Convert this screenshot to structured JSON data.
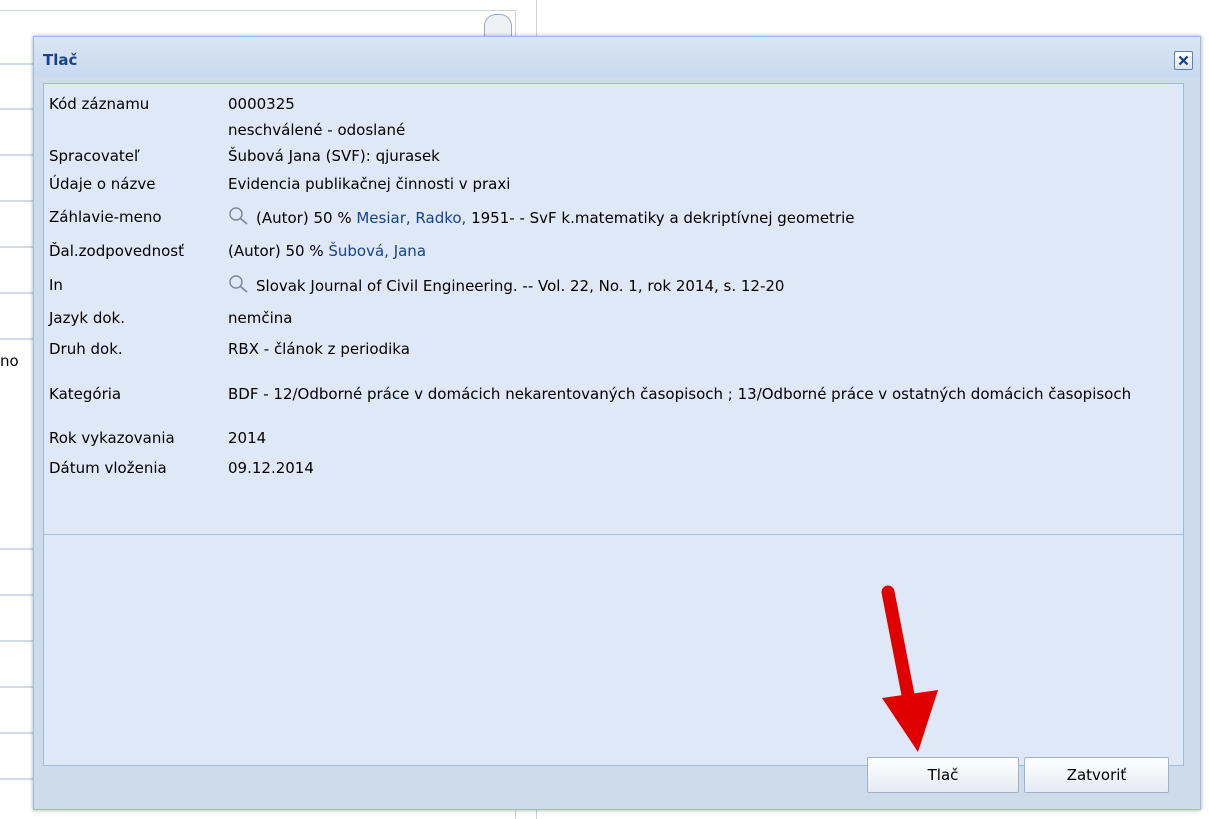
{
  "background": {
    "left_fragment": "no"
  },
  "dialog": {
    "title": "Tlač",
    "rows": [
      {
        "label": "Kód záznamu",
        "value": "0000325"
      },
      {
        "label": "",
        "value": "neschválené - odoslané"
      },
      {
        "label": "Spracovateľ",
        "value": "Šubová Jana (SVF): qjurasek"
      },
      {
        "label": "Údaje o názve",
        "value": "Evidencia publikačnej činnosti v praxi"
      },
      {
        "label": "Záhlavie-meno",
        "prefix": "(Autor) 50 %",
        "link": "Mesiar, Radko,",
        "suffix": "1951- - SvF k.matematiky a dekriptívnej geometrie",
        "icon": "search-icon"
      },
      {
        "label": "Ďal.zodpovednosť",
        "prefix": "(Autor) 50 %",
        "link": "Šubová, Jana"
      },
      {
        "label": "In",
        "value": "Slovak Journal of Civil Engineering. -- Vol. 22, No. 1, rok 2014, s. 12-20",
        "icon": "search-icon"
      },
      {
        "label": "Jazyk dok.",
        "value": "nemčina"
      },
      {
        "label": "Druh dok.",
        "value": "RBX - článok z periodika"
      },
      {
        "label": "Kategória",
        "value": "BDF - 12/Odborné práce v domácich nekarentovaných časopisoch ; 13/Odborné práce v ostatných domácich časopisoch"
      },
      {
        "label": "Rok vykazovania",
        "value": "2014"
      },
      {
        "label": "Dátum vloženia",
        "value": "09.12.2014"
      }
    ],
    "buttons": {
      "print": "Tlač",
      "close": "Zatvoriť"
    }
  },
  "colors": {
    "title": "#15428b",
    "link": "#15428b",
    "arrow": "#e00000",
    "dialog_bg": "#cddbeb"
  }
}
